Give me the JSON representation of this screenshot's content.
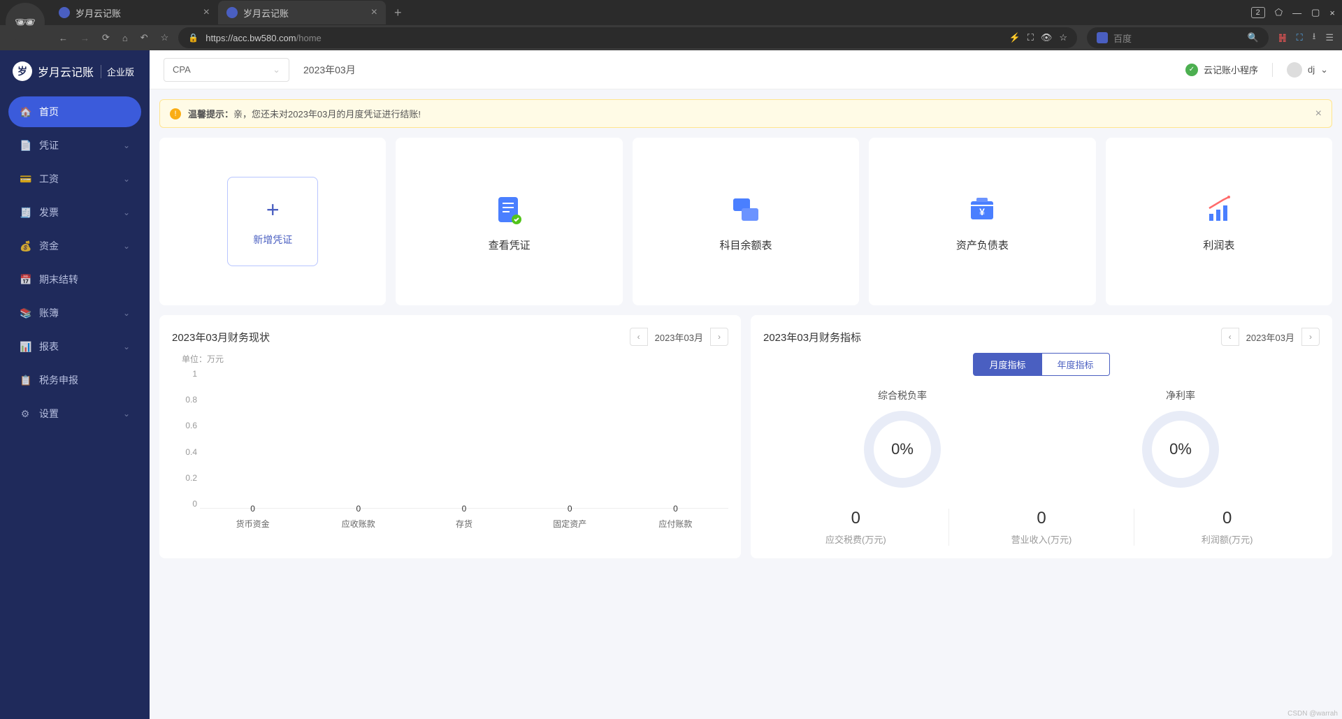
{
  "browser": {
    "tabs": [
      {
        "title": "岁月云记账",
        "active": false
      },
      {
        "title": "岁月云记账",
        "active": true
      }
    ],
    "tab_counter": "2",
    "url_host": "https://acc.bw580.com",
    "url_path": "/home",
    "search_placeholder": "百度"
  },
  "app_logo": {
    "name": "岁月云记账",
    "edition": "企业版"
  },
  "sidebar": {
    "items": [
      {
        "icon": "🏠",
        "label": "首页",
        "active": true,
        "expandable": false
      },
      {
        "icon": "📄",
        "label": "凭证",
        "expandable": true
      },
      {
        "icon": "💳",
        "label": "工资",
        "expandable": true
      },
      {
        "icon": "🧾",
        "label": "发票",
        "expandable": true
      },
      {
        "icon": "💰",
        "label": "资金",
        "expandable": true
      },
      {
        "icon": "📅",
        "label": "期末结转",
        "expandable": false
      },
      {
        "icon": "📚",
        "label": "账簿",
        "expandable": true
      },
      {
        "icon": "📊",
        "label": "报表",
        "expandable": true
      },
      {
        "icon": "📋",
        "label": "税务申报",
        "expandable": false
      },
      {
        "icon": "⚙",
        "label": "设置",
        "expandable": true
      }
    ]
  },
  "topbar": {
    "account_selector": "CPA",
    "period": "2023年03月",
    "mini_program": "云记账小程序",
    "user": "dj"
  },
  "alert": {
    "prefix": "温馨提示：",
    "text": "亲，您还未对2023年03月的月度凭证进行结账!"
  },
  "quick_cards": [
    {
      "type": "add",
      "title": "新增凭证"
    },
    {
      "type": "view",
      "title": "查看凭证"
    },
    {
      "type": "balance",
      "title": "科目余额表"
    },
    {
      "type": "liability",
      "title": "资产负债表"
    },
    {
      "type": "profit",
      "title": "利润表"
    }
  ],
  "panel_left": {
    "title": "2023年03月财务现状",
    "date": "2023年03月",
    "chart_unit": "单位：万元"
  },
  "chart_data": {
    "type": "bar",
    "categories": [
      "货币资金",
      "应收账款",
      "存货",
      "固定资产",
      "应付账款"
    ],
    "values": [
      0,
      0,
      0,
      0,
      0
    ],
    "ylabel": "万元",
    "ylim": [
      0,
      1
    ],
    "yticks": [
      "1",
      "0.8",
      "0.6",
      "0.4",
      "0.2",
      "0"
    ]
  },
  "panel_right": {
    "title": "2023年03月财务指标",
    "date": "2023年03月",
    "tabs": [
      {
        "label": "月度指标",
        "active": true
      },
      {
        "label": "年度指标",
        "active": false
      }
    ],
    "metrics": [
      {
        "label": "综合税负率",
        "value": "0%"
      },
      {
        "label": "净利率",
        "value": "0%"
      }
    ],
    "stats": [
      {
        "value": "0",
        "label": "应交税费(万元)"
      },
      {
        "value": "0",
        "label": "营业收入(万元)"
      },
      {
        "value": "0",
        "label": "利润额(万元)"
      }
    ]
  },
  "watermark": "CSDN @warrah"
}
